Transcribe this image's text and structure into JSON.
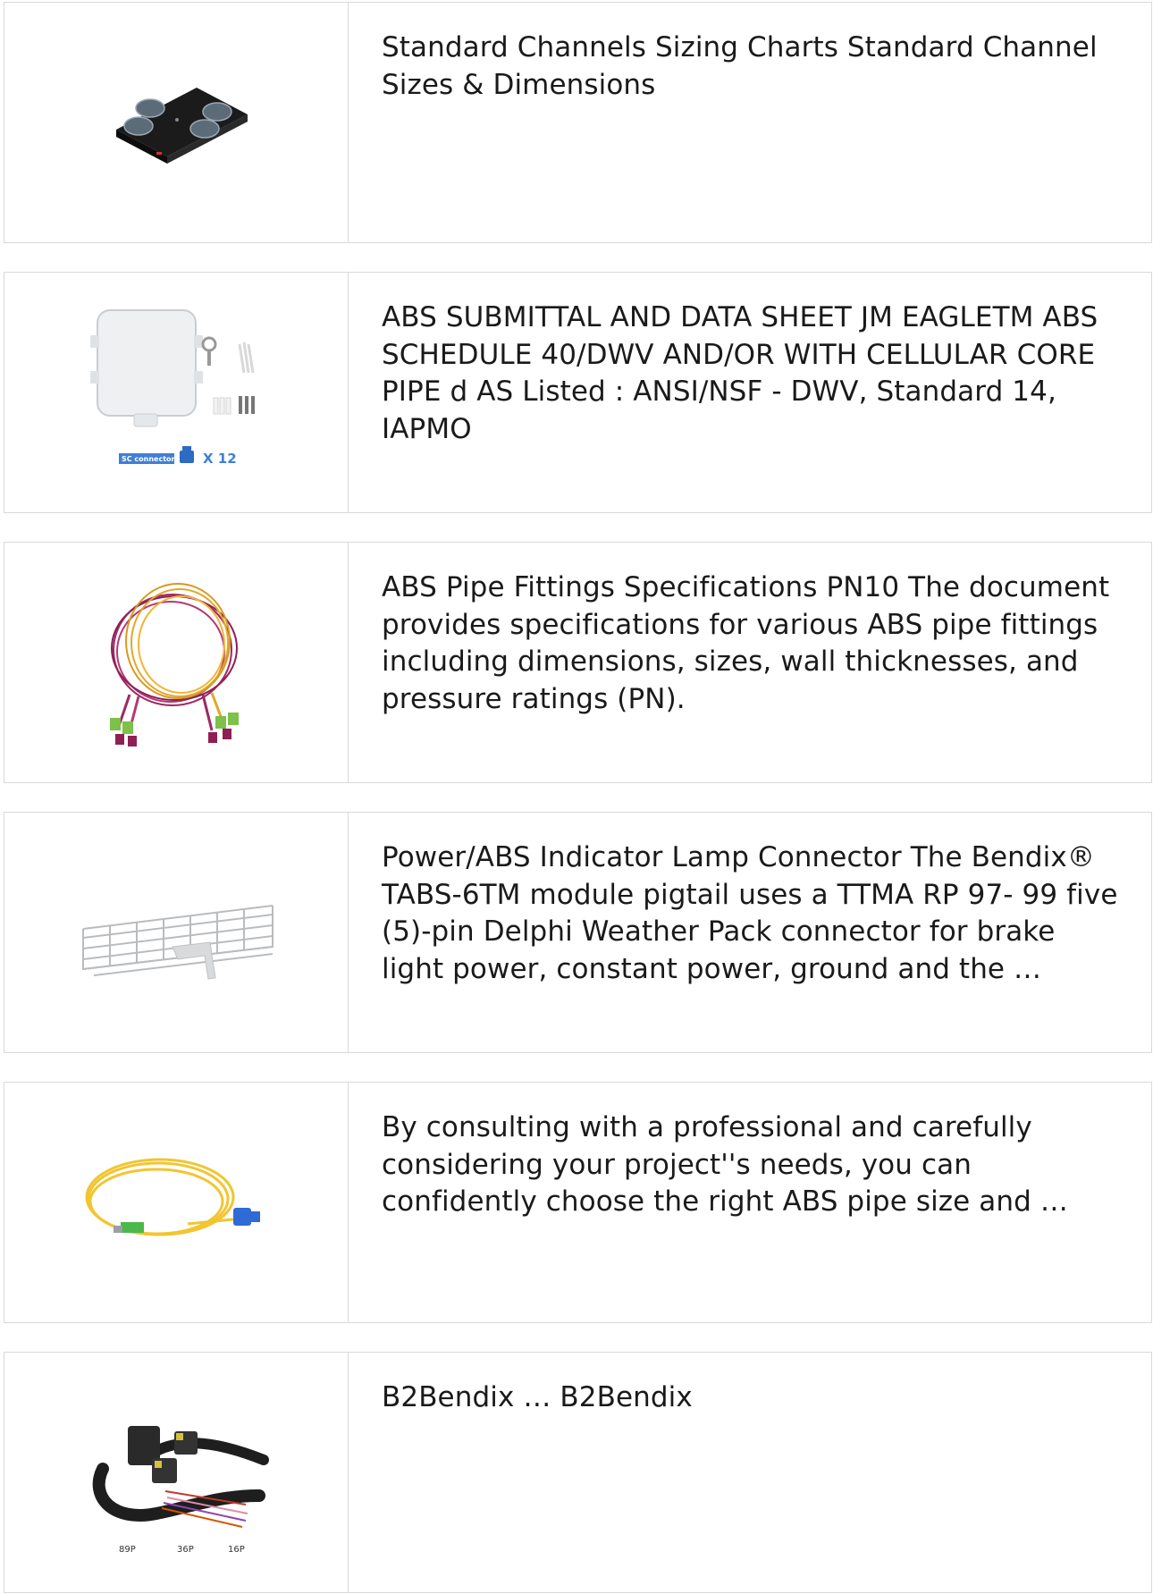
{
  "results": [
    {
      "image_icon": "rack-fan-tray-icon",
      "description": "Standard Channels Sizing Charts Standard Channel Sizes & Dimensions"
    },
    {
      "image_icon": "fiber-terminal-box-icon",
      "description": "ABS SUBMITTAL AND DATA SHEET JM EAGLETM ABS SCHEDULE 40/DWV AND/OR WITH CELLULAR CORE PIPE d AS Listed : ANSI/NSF - DWV, Standard 14, IAPMO",
      "image_labels": {
        "connector": "SC connector",
        "quantity": "X 12"
      }
    },
    {
      "image_icon": "fiber-patch-cord-coils-icon",
      "description": "ABS Pipe Fittings Specifications PN10 The document provides specifications for various ABS pipe fittings including dimensions, sizes, wall thicknesses, and pressure ratings (PN)."
    },
    {
      "image_icon": "wire-mesh-cable-tray-icon",
      "description": "Power/ABS Indicator Lamp Connector The Bendix® TABS-6TM module pigtail uses a TTMA RP 97- 99 five (5)-pin Delphi Weather Pack connector for brake light power, constant power, ground and the …"
    },
    {
      "image_icon": "fiber-patch-cable-icon",
      "description": "By consulting with a professional and carefully considering your project''s needs, you can confidently choose the right ABS pipe size and …"
    },
    {
      "image_icon": "wiring-harness-icon",
      "description": "B2Bendix … B2Bendix",
      "image_labels": {
        "pins": [
          "89P",
          "36P",
          "16P"
        ]
      }
    }
  ]
}
